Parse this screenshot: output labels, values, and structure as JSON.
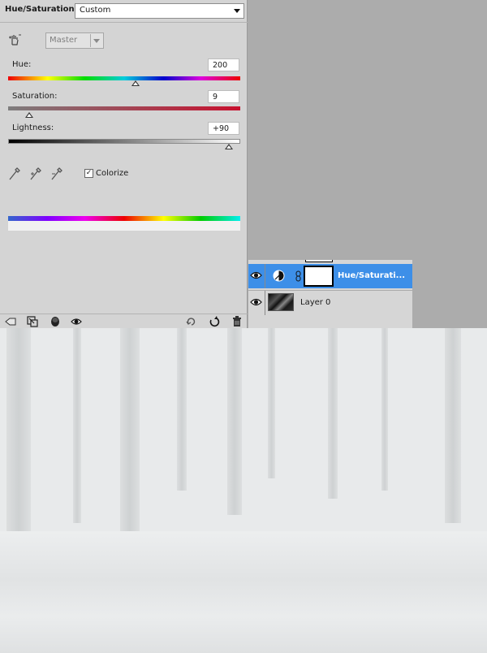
{
  "panel": {
    "title": "Hue/Saturation",
    "preset": "Custom",
    "channel": "Master",
    "hue": {
      "label": "Hue:",
      "value": "200",
      "fraction": 0.55
    },
    "saturation": {
      "label": "Saturation:",
      "value": "9",
      "fraction": 0.09
    },
    "lightness": {
      "label": "Lightness:",
      "value": "+90",
      "fraction": 0.95
    },
    "colorize": {
      "label": "Colorize",
      "checked": true
    }
  },
  "layers": {
    "rows": [
      {
        "name": "Hue/Saturati...",
        "selected": true
      },
      {
        "name": "Layer 0",
        "selected": false
      }
    ]
  },
  "icons": {
    "hand": "targeted-adjustment-icon",
    "eyedroppers": [
      "eyedropper-icon",
      "eyedropper-plus-icon",
      "eyedropper-minus-icon"
    ],
    "footer": [
      "clip-to-layer-icon",
      "view-previous-icon",
      "mask-icon",
      "visibility-icon",
      "reset-icon",
      "undo-icon",
      "delete-icon"
    ]
  },
  "colors": {
    "selection": "#3d8fe8",
    "panel_bg": "#d4d4d4",
    "workspace_bg": "#acacac"
  }
}
